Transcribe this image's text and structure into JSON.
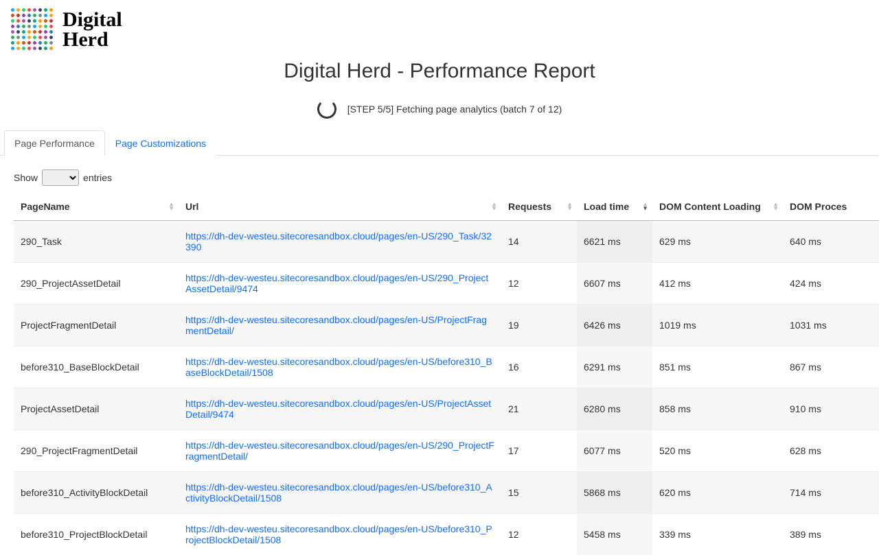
{
  "app": {
    "logo_line1": "Digital",
    "logo_line2": "Herd",
    "title": "Digital Herd - Performance Report",
    "status": "[STEP 5/5] Fetching page analytics (batch 7 of 12)"
  },
  "tabs": {
    "active": "Page Performance",
    "inactive": "Page Customizations"
  },
  "length_menu": {
    "show": "Show",
    "entries": "entries"
  },
  "columns": {
    "pagename": "PageName",
    "url": "Url",
    "requests": "Requests",
    "loadtime": "Load time",
    "domcontent": "DOM Content Loading",
    "domproc": "DOM Proces"
  },
  "rows": [
    {
      "pagename": "290_Task",
      "url": "https://dh-dev-westeu.sitecoresandbox.cloud/pages/en-US/290_Task/32390",
      "requests": "14",
      "loadtime": "6621 ms",
      "domcontent": "629 ms",
      "domproc": "640 ms"
    },
    {
      "pagename": "290_ProjectAssetDetail",
      "url": "https://dh-dev-westeu.sitecoresandbox.cloud/pages/en-US/290_ProjectAssetDetail/9474",
      "requests": "12",
      "loadtime": "6607 ms",
      "domcontent": "412 ms",
      "domproc": "424 ms"
    },
    {
      "pagename": "ProjectFragmentDetail",
      "url": "https://dh-dev-westeu.sitecoresandbox.cloud/pages/en-US/ProjectFragmentDetail/",
      "requests": "19",
      "loadtime": "6426 ms",
      "domcontent": "1019 ms",
      "domproc": "1031 ms"
    },
    {
      "pagename": "before310_BaseBlockDetail",
      "url": "https://dh-dev-westeu.sitecoresandbox.cloud/pages/en-US/before310_BaseBlockDetail/1508",
      "requests": "16",
      "loadtime": "6291 ms",
      "domcontent": "851 ms",
      "domproc": "867 ms"
    },
    {
      "pagename": "ProjectAssetDetail",
      "url": "https://dh-dev-westeu.sitecoresandbox.cloud/pages/en-US/ProjectAssetDetail/9474",
      "requests": "21",
      "loadtime": "6280 ms",
      "domcontent": "858 ms",
      "domproc": "910 ms"
    },
    {
      "pagename": "290_ProjectFragmentDetail",
      "url": "https://dh-dev-westeu.sitecoresandbox.cloud/pages/en-US/290_ProjectFragmentDetail/",
      "requests": "17",
      "loadtime": "6077 ms",
      "domcontent": "520 ms",
      "domproc": "628 ms"
    },
    {
      "pagename": "before310_ActivityBlockDetail",
      "url": "https://dh-dev-westeu.sitecoresandbox.cloud/pages/en-US/before310_ActivityBlockDetail/1508",
      "requests": "15",
      "loadtime": "5868 ms",
      "domcontent": "620 ms",
      "domproc": "714 ms"
    },
    {
      "pagename": "before310_ProjectBlockDetail",
      "url": "https://dh-dev-westeu.sitecoresandbox.cloud/pages/en-US/before310_ProjectBlockDetail/1508",
      "requests": "12",
      "loadtime": "5458 ms",
      "domcontent": "339 ms",
      "domproc": "389 ms"
    }
  ],
  "logo_colors": [
    "#1aa3ff",
    "#f5a623",
    "#2ecc71",
    "#e74c3c",
    "#9b59b6",
    "#34495e",
    "#16a085",
    "#f39c12",
    "#d35400",
    "#c0392b",
    "#8e44ad",
    "#2980b9",
    "#27ae60",
    "#7f8c8d"
  ]
}
